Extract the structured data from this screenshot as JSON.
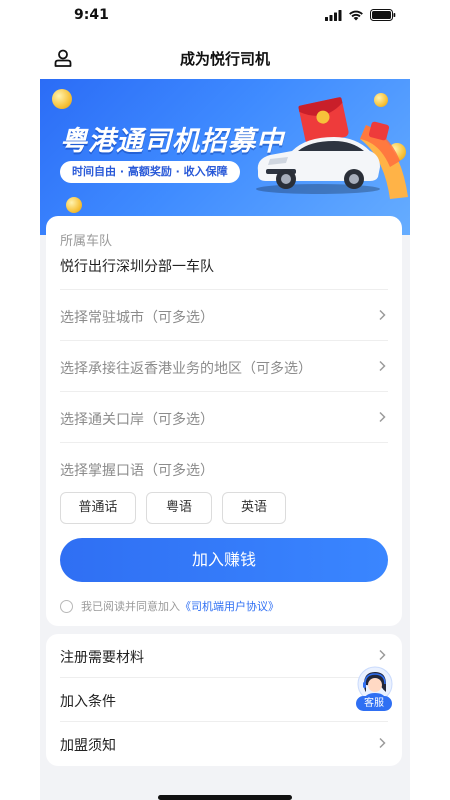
{
  "status_bar": {
    "time": "9:41"
  },
  "nav": {
    "title": "成为悦行司机",
    "user_icon": "user-icon"
  },
  "banner": {
    "title": "粤港通司机招募中",
    "subtitle": "时间自由 · 高额奖励 · 收入保障",
    "accent": "#2b6cf6"
  },
  "form": {
    "team_label": "所属车队",
    "team_value": "悦行出行深圳分部一车队",
    "city_placeholder": "选择常驻城市（可多选）",
    "region_placeholder": "选择承接往返香港业务的地区（可多选）",
    "port_placeholder": "选择通关口岸（可多选）",
    "language_label": "选择掌握口语（可多选）",
    "languages": [
      "普通话",
      "粤语",
      "英语"
    ],
    "join_button": "加入赚钱",
    "agree_text": "我已阅读并同意加入",
    "agree_link": "《司机端用户协议》"
  },
  "info_list": {
    "items": [
      "注册需要材料",
      "加入条件",
      "加盟须知"
    ]
  },
  "customer_service": {
    "label": "客服"
  }
}
